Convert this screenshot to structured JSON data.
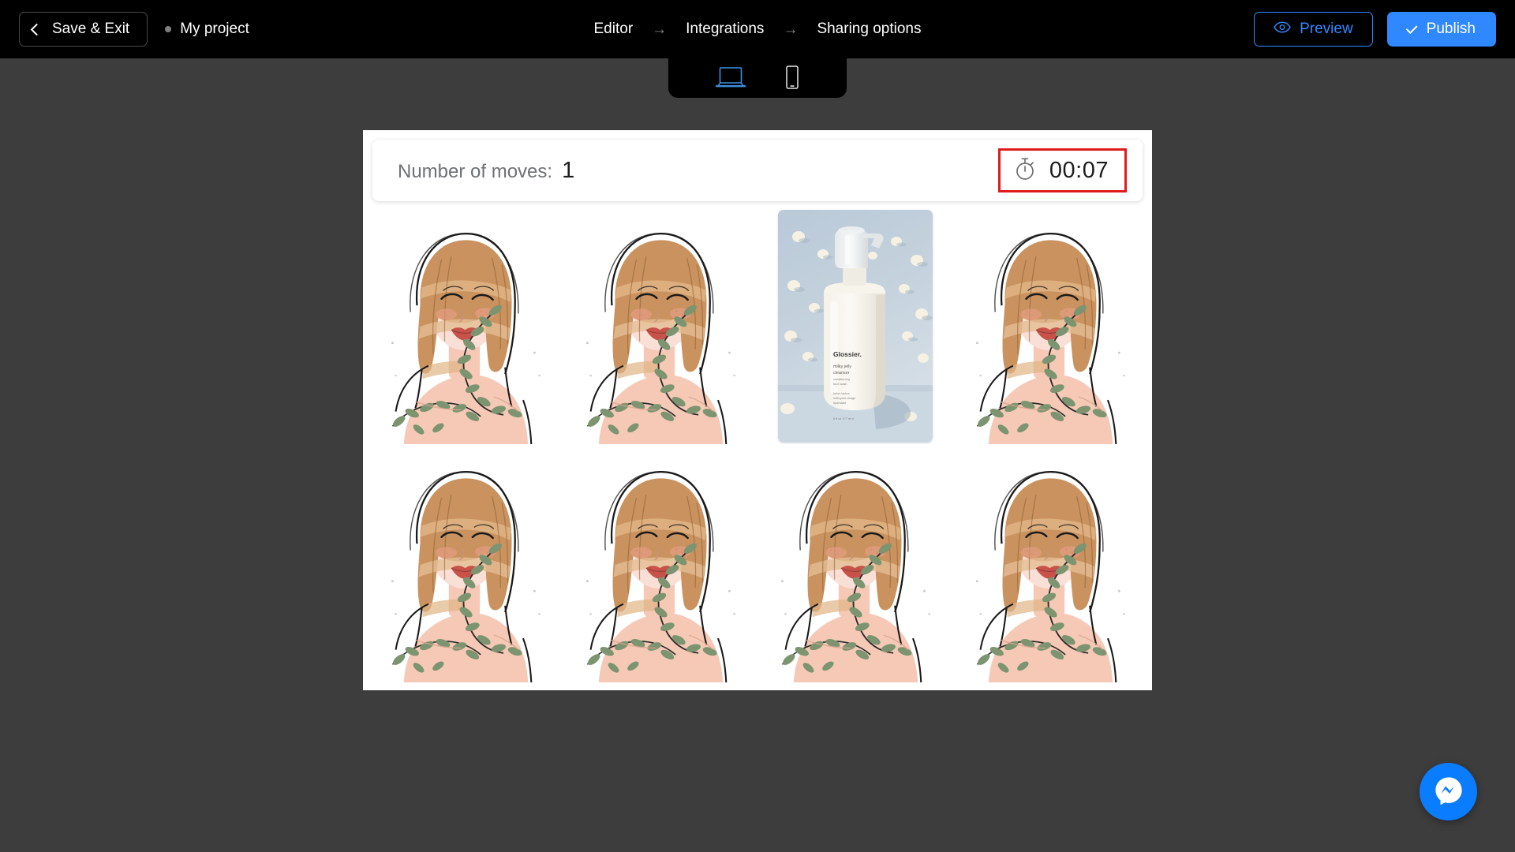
{
  "topbar": {
    "save_exit_label": "Save & Exit",
    "project_name": "My project",
    "breadcrumbs": [
      {
        "label": "Editor"
      },
      {
        "label": "Integrations"
      },
      {
        "label": "Sharing options"
      }
    ],
    "breadcrumb_separator": "→",
    "preview_label": "Preview",
    "publish_label": "Publish",
    "accent_color": "#2f88ff",
    "bar_color": "#000000"
  },
  "device_toggle": {
    "options": [
      {
        "name": "desktop",
        "active": true,
        "color": "#3b8fe0"
      },
      {
        "name": "mobile",
        "active": false,
        "color": "#e8e8e8"
      }
    ]
  },
  "canvas": {
    "background": "#ffffff",
    "page_background": "#3d3d3d"
  },
  "game": {
    "moves_label": "Number of moves:",
    "moves_value": "1",
    "timer_value": "00:07",
    "timer_highlight_color": "#e01b1b",
    "grid": {
      "columns": 4,
      "rows": 2,
      "cards": [
        {
          "index": 1,
          "state": "face-down",
          "art": "woman-botanical-illustration"
        },
        {
          "index": 2,
          "state": "face-down",
          "art": "woman-botanical-illustration"
        },
        {
          "index": 3,
          "state": "face-up",
          "art": "glossier-milky-jelly-cleanser-photo",
          "brand": "Glossier.",
          "product_line_1": "milky jelly",
          "product_line_2": "cleanser",
          "product_line_3": "conditioning",
          "product_line_4": "face wash",
          "product_volume": "6 fl oz  177 ml ⓔ"
        },
        {
          "index": 4,
          "state": "face-down",
          "art": "woman-botanical-illustration"
        },
        {
          "index": 5,
          "state": "face-down",
          "art": "woman-botanical-illustration"
        },
        {
          "index": 6,
          "state": "face-down",
          "art": "woman-botanical-illustration"
        },
        {
          "index": 7,
          "state": "face-down",
          "art": "woman-botanical-illustration"
        },
        {
          "index": 8,
          "state": "face-down",
          "art": "woman-botanical-illustration"
        }
      ]
    }
  },
  "messenger": {
    "icon": "messenger-icon",
    "color": "#0a7cff"
  }
}
